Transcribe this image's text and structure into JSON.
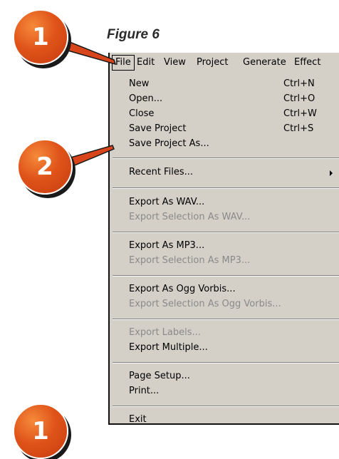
{
  "figure_title": "Figure 6",
  "menubar": [
    "File",
    "Edit",
    "View",
    "Project",
    "Generate",
    "Effect"
  ],
  "menu_items": [
    {
      "label": "New",
      "shortcut": "Ctrl+N"
    },
    {
      "label": "Open...",
      "shortcut": "Ctrl+O"
    },
    {
      "label": "Close",
      "shortcut": "Ctrl+W"
    },
    {
      "label": "Save Project",
      "shortcut": "Ctrl+S"
    },
    {
      "label": "Save Project As..."
    },
    {
      "label": "Recent Files..."
    },
    {
      "label": "Export As WAV..."
    },
    {
      "label": "Export Selection As WAV..."
    },
    {
      "label": "Export As MP3..."
    },
    {
      "label": "Export Selection As MP3..."
    },
    {
      "label": "Export As Ogg Vorbis..."
    },
    {
      "label": "Export Selection As Ogg Vorbis..."
    },
    {
      "label": "Export Labels..."
    },
    {
      "label": "Export Multiple..."
    },
    {
      "label": "Page Setup..."
    },
    {
      "label": "Print..."
    },
    {
      "label": "Exit"
    }
  ],
  "callouts": [
    "1",
    "2",
    "1"
  ],
  "colors": {
    "callout": "#e0541a",
    "menu_bg": "#d4d0c8",
    "disabled": "#8a8a8a"
  }
}
